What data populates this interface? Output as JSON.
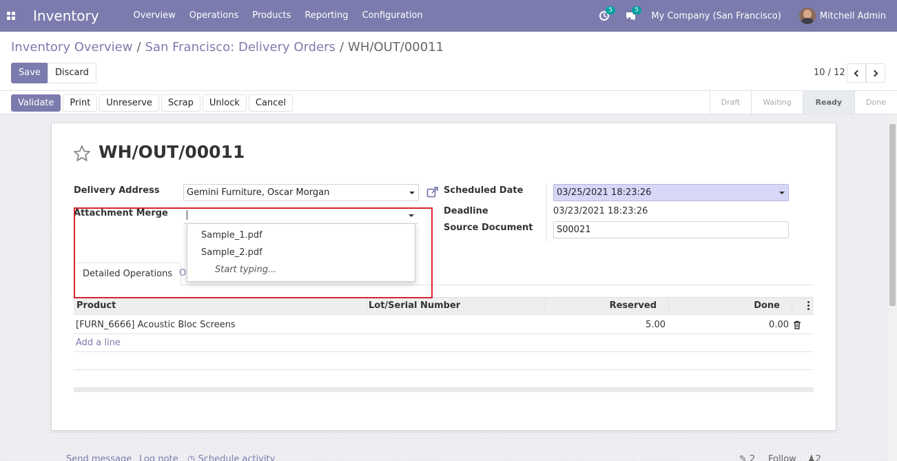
{
  "navbar": {
    "app_name": "Inventory",
    "menu": [
      "Overview",
      "Operations",
      "Products",
      "Reporting",
      "Configuration"
    ],
    "activity_count": "5",
    "message_count": "5",
    "company": "My Company (San Francisco)",
    "user": "Mitchell Admin"
  },
  "breadcrumb": {
    "items": [
      "Inventory Overview",
      "San Francisco: Delivery Orders"
    ],
    "current": "WH/OUT/00011"
  },
  "control": {
    "save_label": "Save",
    "discard_label": "Discard",
    "pager": "10 / 12"
  },
  "statusbar": {
    "actions": [
      "Validate",
      "Print",
      "Unreserve",
      "Scrap",
      "Unlock",
      "Cancel"
    ],
    "stages": [
      "Draft",
      "Waiting",
      "Ready",
      "Done"
    ],
    "current_stage": "Ready"
  },
  "record": {
    "title": "WH/OUT/00011",
    "delivery_address_label": "Delivery Address",
    "delivery_address": "Gemini Furniture, Oscar Morgan",
    "attachment_merge_label": "Attachment Merge",
    "attachment_merge_value": "",
    "scheduled_date_label": "Scheduled Date",
    "scheduled_date": "03/25/2021 18:23:26",
    "deadline_label": "Deadline",
    "deadline": "03/23/2021 18:23:26",
    "source_document_label": "Source Document",
    "source_document": "S00021"
  },
  "dropdown": {
    "options": [
      "Sample_1.pdf",
      "Sample_2.pdf"
    ],
    "hint": "Start typing..."
  },
  "tabs": {
    "active": "Detailed Operations",
    "other_partial": "O"
  },
  "table": {
    "columns": [
      "Product",
      "Lot/Serial Number",
      "Reserved",
      "Done"
    ],
    "rows": [
      {
        "product": "[FURN_6666] Acoustic Bloc Screens",
        "lot": "",
        "reserved": "5.00",
        "done": "0.00"
      }
    ],
    "add_line": "Add a line"
  },
  "chatter": {
    "send_message": "Send message",
    "log_note": "Log note",
    "schedule_activity": "Schedule activity",
    "attachments": "2",
    "follow": "Follow",
    "followers": "2"
  },
  "colors": {
    "brand": "#7c7bad",
    "highlight": "#d7d7f7",
    "annotation_red": "#d8232a"
  }
}
